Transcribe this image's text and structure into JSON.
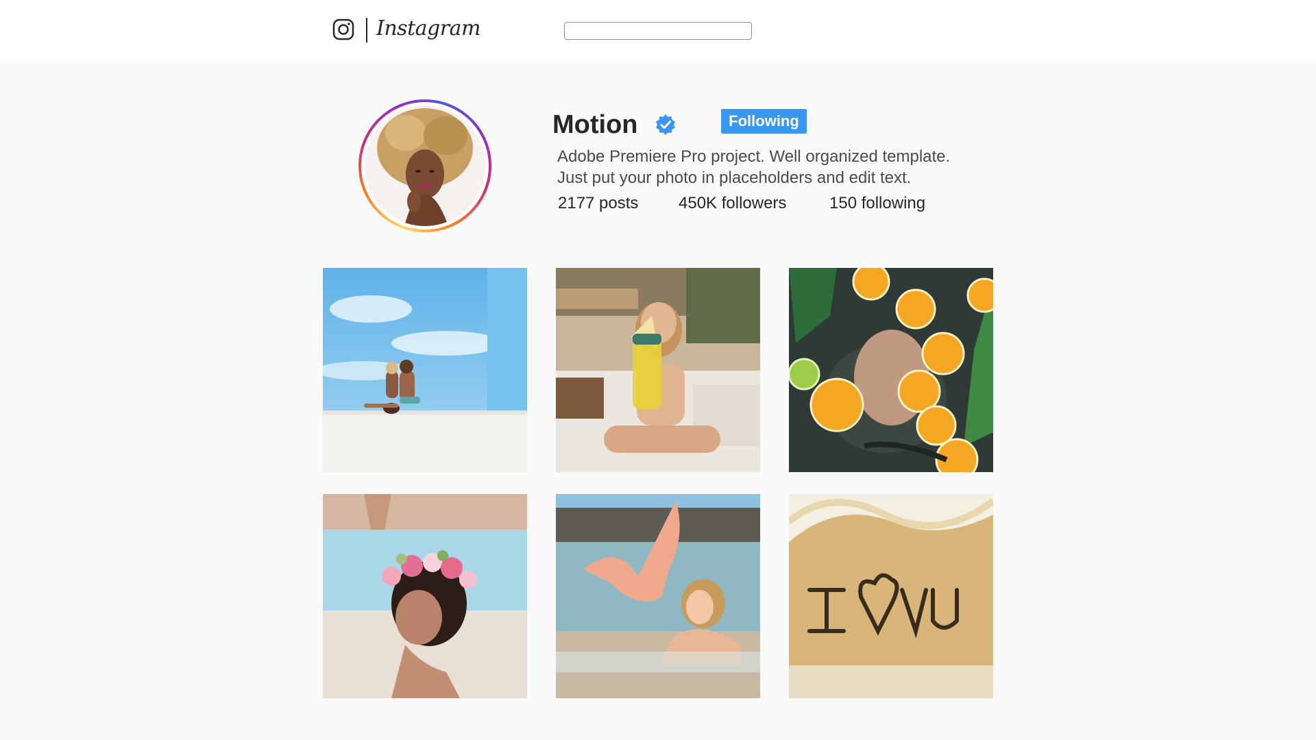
{
  "app": {
    "brand": "Instagram",
    "icon": "instagram-camera-icon"
  },
  "search": {
    "value": "",
    "placeholder": ""
  },
  "profile": {
    "username": "Motion",
    "verified_icon": "verified-badge-icon",
    "follow_label": "Following",
    "bio_line1": "Adobe Premiere Pro project. Well organized template.",
    "bio_line2": "Just put your photo in placeholders and edit text.",
    "stats": {
      "posts": "2177 posts",
      "followers": "450K followers",
      "following": "150 following"
    }
  },
  "colors": {
    "accent": "#3897f0",
    "text": "#262626",
    "background": "#f9f9f9",
    "story_ring": [
      "#feda75",
      "#fa7e1e",
      "#d62976",
      "#962fbf",
      "#4f5bd5"
    ]
  },
  "posts": [
    {
      "name": "beach-couple"
    },
    {
      "name": "woman-with-drink"
    },
    {
      "name": "oranges-in-water"
    },
    {
      "name": "flower-crown-woman"
    },
    {
      "name": "mermaid-tail"
    },
    {
      "name": "i-love-u-sand"
    }
  ]
}
